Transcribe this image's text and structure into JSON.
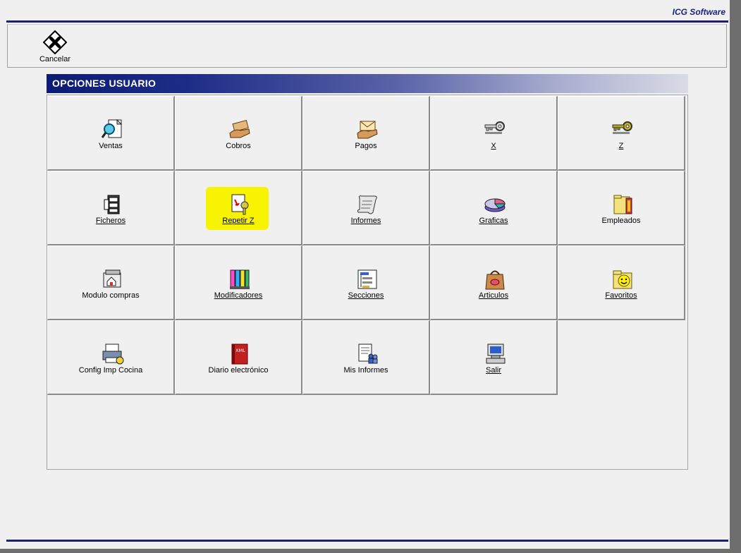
{
  "brand": "ICG Software",
  "toolbar": {
    "cancel_label": "Cancelar"
  },
  "section_title": "OPCIONES USUARIO",
  "tiles": [
    {
      "label": "Ventas",
      "icon": "magnifier-document-icon",
      "underline": false
    },
    {
      "label": "Cobros",
      "icon": "hand-money-icon",
      "underline": false
    },
    {
      "label": "Pagos",
      "icon": "hand-envelope-icon",
      "underline": false
    },
    {
      "label": "X",
      "icon": "silver-key-icon",
      "underline": true
    },
    {
      "label": "Z",
      "icon": "gold-key-icon",
      "underline": true
    },
    {
      "label": "Ficheros",
      "icon": "filing-cabinet-icon",
      "underline": true
    },
    {
      "label": "Repetir Z",
      "icon": "document-key-icon",
      "underline": true,
      "highlighted": true
    },
    {
      "label": "Informes",
      "icon": "scroll-icon",
      "underline": true
    },
    {
      "label": "Graficas",
      "icon": "pie-chart-icon",
      "underline": true
    },
    {
      "label": "Empleados",
      "icon": "employees-folder-icon",
      "underline": false
    },
    {
      "label": "Modulo compras",
      "icon": "purchases-module-icon",
      "underline": false
    },
    {
      "label": "Modificadores",
      "icon": "chess-pieces-icon",
      "underline": true
    },
    {
      "label": "Secciones",
      "icon": "sections-tree-icon",
      "underline": true
    },
    {
      "label": "Articulos",
      "icon": "shopping-bag-icon",
      "underline": true
    },
    {
      "label": "Favoritos",
      "icon": "smiley-folder-icon",
      "underline": true
    },
    {
      "label": "Config Imp Cocina",
      "icon": "kitchen-printer-icon",
      "underline": false
    },
    {
      "label": "Diario electrónico",
      "icon": "xml-book-icon",
      "underline": false
    },
    {
      "label": "Mis Informes",
      "icon": "report-users-icon",
      "underline": false
    },
    {
      "label": "Salir",
      "icon": "exit-computer-icon",
      "underline": true
    }
  ],
  "colors": {
    "header_start": "#0c1b74",
    "header_end": "#dadbe6",
    "highlight": "#f8f300",
    "brand": "#1a237e"
  }
}
